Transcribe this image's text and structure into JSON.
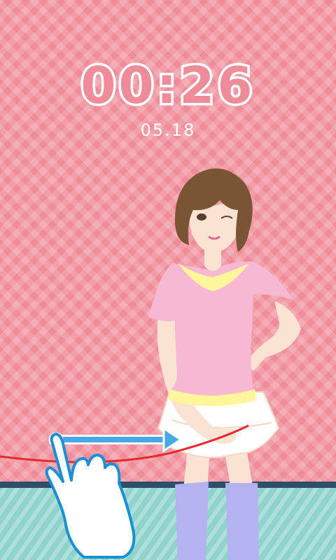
{
  "lockscreen": {
    "clock": "00:26",
    "date": "05.18"
  },
  "colors": {
    "background": "#f08c99",
    "floor": "#8fd3cc",
    "unlock_line": "#e5292f",
    "arrow": "#46a9e3"
  },
  "icons": {
    "swipe_hand": "pointing-hand-icon",
    "swipe_arrow": "right-arrow-icon"
  }
}
